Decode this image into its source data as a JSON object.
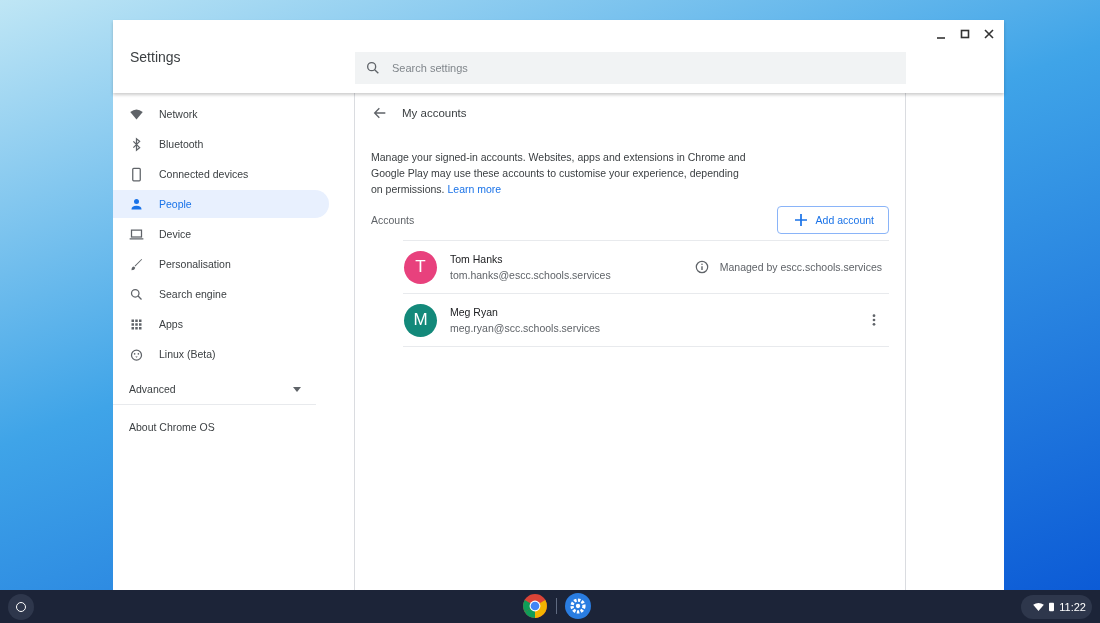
{
  "window": {
    "title": "Settings"
  },
  "search": {
    "placeholder": "Search settings"
  },
  "sidebar": {
    "items": [
      {
        "label": "Network",
        "selected": false
      },
      {
        "label": "Bluetooth",
        "selected": false
      },
      {
        "label": "Connected devices",
        "selected": false
      },
      {
        "label": "People",
        "selected": true
      },
      {
        "label": "Device",
        "selected": false
      },
      {
        "label": "Personalisation",
        "selected": false
      },
      {
        "label": "Search engine",
        "selected": false
      },
      {
        "label": "Apps",
        "selected": false
      },
      {
        "label": "Linux (Beta)",
        "selected": false
      }
    ],
    "advanced": {
      "label": "Advanced",
      "expanded": false
    },
    "about": "About Chrome OS"
  },
  "page": {
    "title": "My accounts",
    "description": "Manage your signed-in accounts. Websites, apps and extensions in Chrome and Google Play may use these accounts to customise your experience, depending on permissions.",
    "learn_more": "Learn more",
    "accounts_label": "Accounts",
    "add_button": "Add account",
    "accounts": [
      {
        "initial": "T",
        "color": "#e8417d",
        "name": "Tom Hanks",
        "email": "tom.hanks@escc.schools.services",
        "kind": "managed",
        "note": "Managed by escc.schools.services"
      },
      {
        "initial": "M",
        "color": "#13897a",
        "name": "Meg Ryan",
        "email": "meg.ryan@scc.schools.services",
        "kind": "menu"
      }
    ]
  },
  "shelf": {
    "time": "11:22"
  }
}
